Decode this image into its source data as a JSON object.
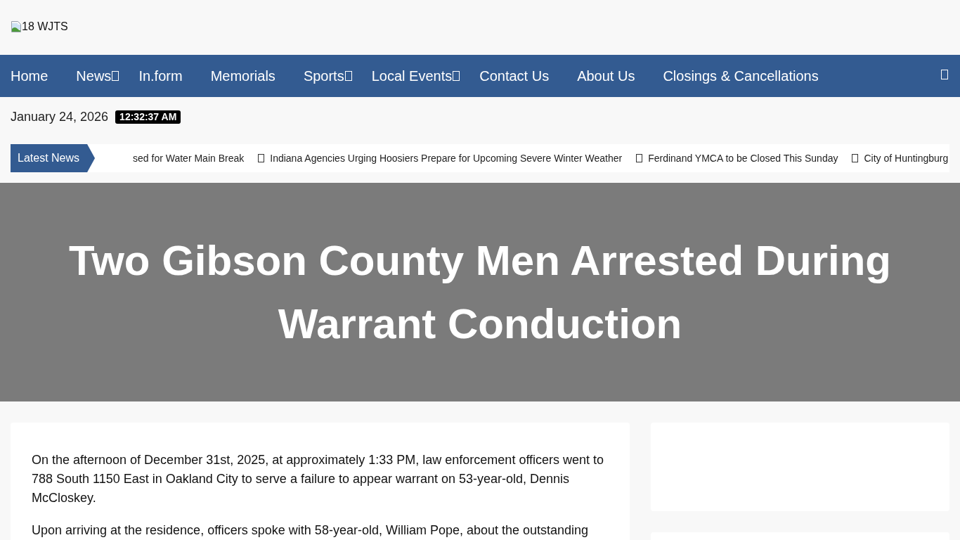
{
  "header": {
    "logo_alt_text": "18 WJTS"
  },
  "nav": {
    "items": [
      {
        "label": "Home",
        "dropdown": false
      },
      {
        "label": "News",
        "dropdown": true
      },
      {
        "label": "In.form",
        "dropdown": false
      },
      {
        "label": "Memorials",
        "dropdown": false
      },
      {
        "label": "Sports",
        "dropdown": true
      },
      {
        "label": "Local Events",
        "dropdown": true
      },
      {
        "label": "Contact Us",
        "dropdown": false
      },
      {
        "label": "About Us",
        "dropdown": false
      },
      {
        "label": "Closings & Cancellations",
        "dropdown": false
      }
    ]
  },
  "date_bar": {
    "date": "January 24, 2026",
    "time": "12:32:37 AM"
  },
  "ticker": {
    "label": "Latest News",
    "items": [
      "sed for Water Main Break",
      "Indiana Agencies Urging Hoosiers Prepare for Upcoming Severe Winter Weather",
      "Ferdinand YMCA to be Closed This Sunday",
      "City of Huntingburg"
    ]
  },
  "hero": {
    "title": "Two Gibson County Men Arrested During Warrant Conduction"
  },
  "article": {
    "paragraphs": [
      "On the afternoon of December 31st, 2025, at approximately 1:33 PM, law enforcement officers went to 788 South 1150 East in Oakland City to serve a failure to appear warrant on 53-year-old, Dennis McCloskey.",
      "Upon arriving at the residence, officers spoke with 58-year-old, William Pope, about the outstanding"
    ]
  }
}
